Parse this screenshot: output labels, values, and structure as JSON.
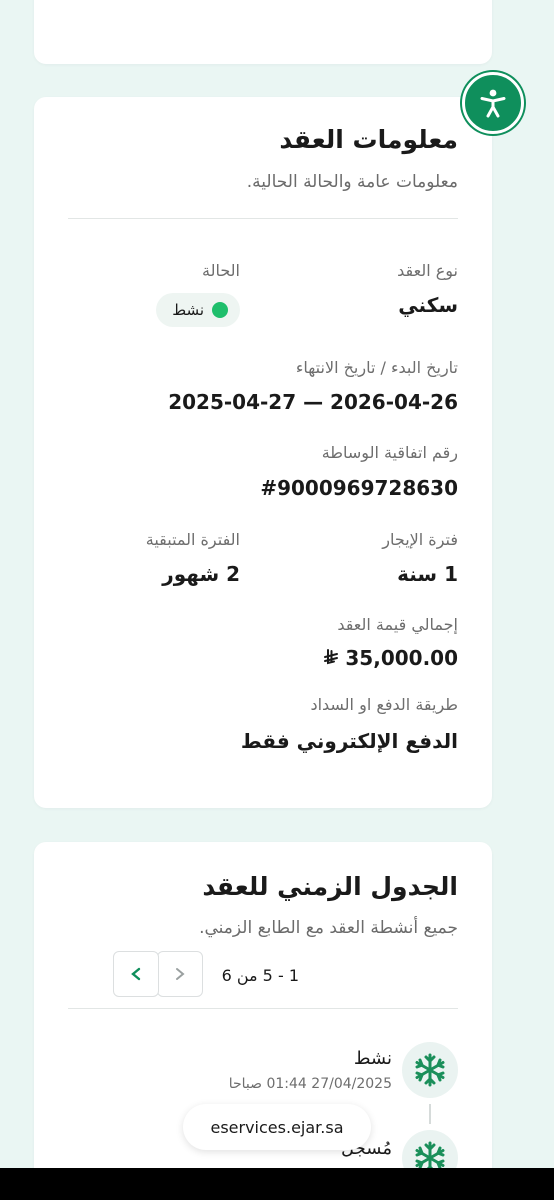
{
  "contract_info": {
    "title": "معلومات العقد",
    "subtitle": "معلومات عامة والحالة الحالية.",
    "contract_type": {
      "label": "نوع العقد",
      "value": "سكني"
    },
    "status": {
      "label": "الحالة",
      "value": "نشط",
      "color": "#1fbf6c"
    },
    "dates": {
      "label": "تاريخ البدء / تاريخ الانتهاء",
      "value": "2025-04-27 — 2026-04-26"
    },
    "brokerage": {
      "label": "رقم اتفاقية الوساطة",
      "value": "#9000969728630"
    },
    "lease_period": {
      "label": "فترة الإيجار",
      "value": "1 سنة"
    },
    "remaining_period": {
      "label": "الفترة المتبقية",
      "value": "2 شهور"
    },
    "total_value": {
      "label": "إجمالي قيمة العقد",
      "value": "35,000.00",
      "currency_icon": "riyal-icon"
    },
    "payment_method": {
      "label": "طريقة الدفع او السداد",
      "value": "الدفع الإلكتروني فقط"
    }
  },
  "timeline": {
    "title": "الجدول الزمني للعقد",
    "subtitle": "جميع أنشطة العقد مع الطابع الزمني.",
    "pagination": {
      "range": "1 - 5 من 6",
      "current_page": "1"
    },
    "items": [
      {
        "title": "نشط",
        "date": "27/04/2025 01:44 صباحا",
        "icon": "snowflake-icon"
      },
      {
        "title": "مُسجل",
        "date": "",
        "icon": "snowflake-icon"
      }
    ]
  },
  "browser": {
    "url": "eservices.ejar.sa"
  },
  "colors": {
    "accent": "#0f8f5c",
    "background": "#eaf6f3"
  }
}
